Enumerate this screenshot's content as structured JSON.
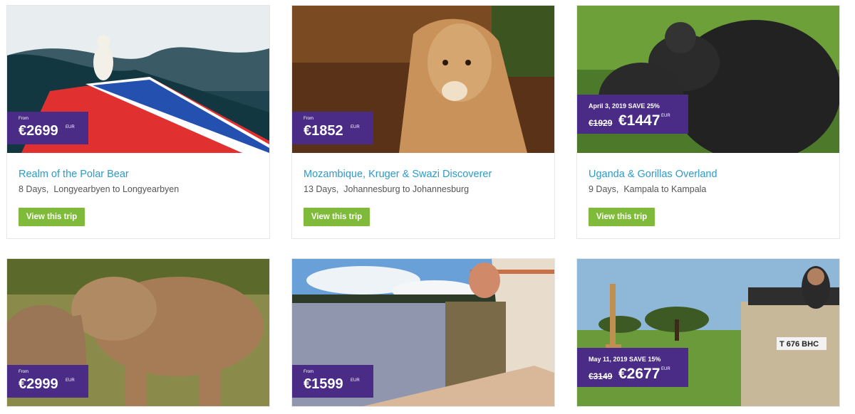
{
  "trips": [
    {
      "title": "Realm of the Polar Bear",
      "days": "8 Days,",
      "route": "Longyearbyen to Longyearbyen",
      "from_label": "From",
      "price": "€2699",
      "currency": "EUR",
      "button": "View this trip"
    },
    {
      "title": "Mozambique, Kruger & Swazi Discoverer",
      "days": "13 Days,",
      "route": "Johannesburg to Johannesburg",
      "from_label": "From",
      "price": "€1852",
      "currency": "EUR",
      "button": "View this trip"
    },
    {
      "title": "Uganda & Gorillas Overland",
      "days": "9 Days,",
      "route": "Kampala to Kampala",
      "sale_text": "April 3, 2019  SAVE 25%",
      "old_price": "€1929",
      "price": "€1447",
      "currency": "EUR",
      "button": "View this trip"
    },
    {
      "from_label": "From",
      "price": "€2999",
      "currency": "EUR"
    },
    {
      "from_label": "From",
      "price": "€1599",
      "currency": "EUR"
    },
    {
      "sale_text": "May 11, 2019  SAVE 15%",
      "old_price": "€3149",
      "price": "€2677",
      "currency": "EUR",
      "vehicle_plate": "T 676 BHC"
    }
  ],
  "images": [
    "polar-bear-ship-photo",
    "lioness-photo",
    "gorilla-photo",
    "elephants-photo",
    "river-cruise-photo",
    "giraffe-safari-photo"
  ]
}
